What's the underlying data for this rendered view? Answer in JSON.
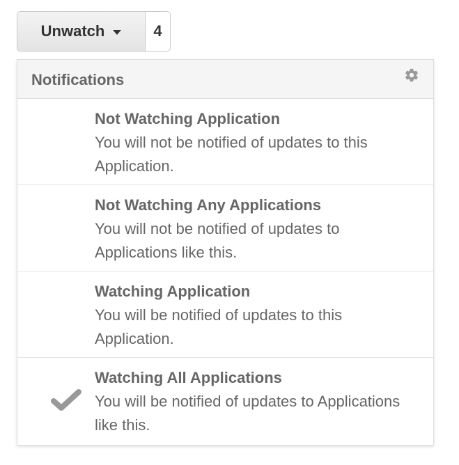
{
  "watch_button": {
    "label": "Unwatch",
    "count": "4"
  },
  "menu": {
    "title": "Notifications",
    "settings_icon": "gear-icon",
    "items": [
      {
        "title": "Not Watching Application",
        "description": "You will not be notified of updates to this Application.",
        "selected": false
      },
      {
        "title": "Not Watching Any Applications",
        "description": "You will not be notified of updates to Applications like this.",
        "selected": false
      },
      {
        "title": "Watching Application",
        "description": "You will be notified of updates to this Application.",
        "selected": false
      },
      {
        "title": "Watching All Applications",
        "description": "You will be notified of updates to Applications like this.",
        "selected": true,
        "selected_icon": "checkmark-icon"
      }
    ]
  },
  "colors": {
    "text": "#666666",
    "button_text": "#333333",
    "header_bg": "#f5f5f5",
    "border": "#dddddd",
    "checkmark": "#999999"
  }
}
